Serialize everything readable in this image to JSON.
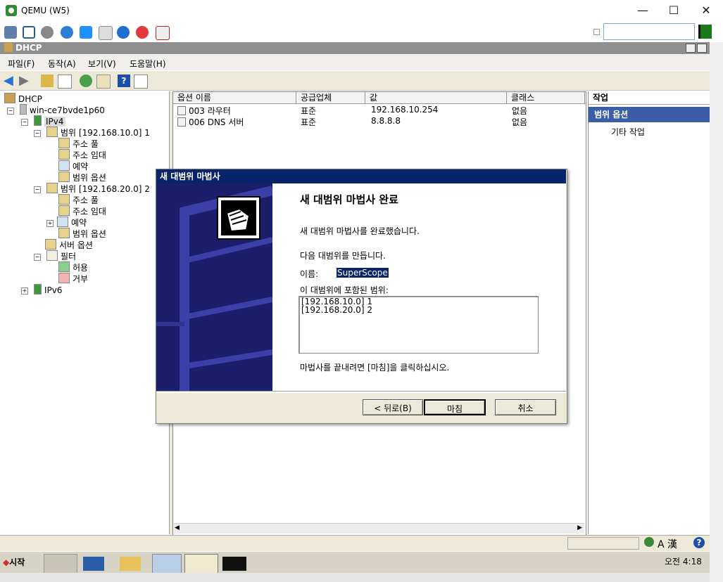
{
  "qemu": {
    "title": "QEMU (W5)",
    "controls": {
      "minimize": "—",
      "maximize": "☐",
      "close": "✕"
    }
  },
  "mmc": {
    "title": "DHCP"
  },
  "menu": [
    "파일(F)",
    "동작(A)",
    "보기(V)",
    "도움말(H)"
  ],
  "tree": {
    "root": "DHCP",
    "server": "win-ce7bvde1p60",
    "ipv4": "IPv4",
    "scope1": "범위 [192.168.10.0] 1",
    "scope1_items": [
      "주소 풀",
      "주소 임대",
      "예약",
      "범위 옵션"
    ],
    "scope2": "범위 [192.168.20.0] 2",
    "scope2_items": [
      "주소 풀",
      "주소 임대",
      "예약",
      "범위 옵션"
    ],
    "server_options": "서버 옵션",
    "filters": "필터",
    "filter_items": [
      "허용",
      "거부"
    ],
    "ipv6": "IPv6"
  },
  "list": {
    "columns": [
      "옵션 이름",
      "공급업체",
      "값",
      "클래스"
    ],
    "rows": [
      {
        "name": "003 라우터",
        "vendor": "표준",
        "value": "192.168.10.254",
        "class": "없음"
      },
      {
        "name": "006 DNS 서버",
        "vendor": "표준",
        "value": "8.8.8.8",
        "class": "없음"
      }
    ]
  },
  "actions": {
    "header": "작업",
    "section": "범위 옵션",
    "more": "기타 작업"
  },
  "wizard": {
    "title": "새 대범위 마법사",
    "heading": "새 대범위 마법사 완료",
    "completed": "새 대범위 마법사를 완료했습니다.",
    "create_text": "다음 대범위를 만듭니다.",
    "name_label": "이름:",
    "name_value": "SuperScope",
    "ranges_label": "이 대범위에 포함된 범위:",
    "ranges": [
      "[192.168.10.0] 1",
      "[192.168.20.0] 2"
    ],
    "finish_hint": "마법사를 끝내려면 [마침]을 클릭하십시오.",
    "back_button": "< 뒤로(B)",
    "finish_button": "마침",
    "cancel_button": "취소"
  },
  "taskbar": {
    "start": "시작",
    "clock": "오전 4:18"
  },
  "statusbar": {
    "ime": "A 漢"
  }
}
